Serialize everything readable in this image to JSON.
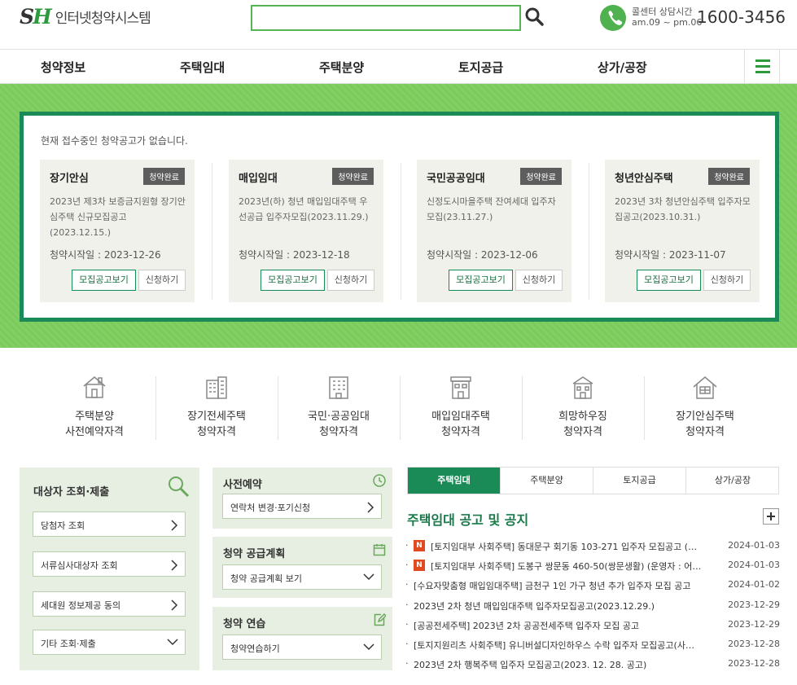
{
  "header": {
    "logo_mark_a": "S",
    "logo_mark_b": "H",
    "logo_name": "인터넷청약시스템",
    "search_placeholder": "",
    "call_label": "콜센터 상담시간",
    "call_hours": "am.09 ~ pm.06",
    "phone": "1600-3456"
  },
  "nav": [
    "청약정보",
    "주택임대",
    "주택분양",
    "토지공급",
    "상가/공장"
  ],
  "notice_box": {
    "empty_text": "현재 접수중인 청약공고가 없습니다.",
    "cards": [
      {
        "title": "장기안심",
        "badge": "청약완료",
        "desc": "2023년 제3차 보증금지원형 장기안심주택 신규모집공고(2023.12.15.)",
        "date": "청약시작일 : 2023-12-26",
        "view": "모집공고보기",
        "apply": "신청하기"
      },
      {
        "title": "매입임대",
        "badge": "청약완료",
        "desc": "2023년(하) 청년 매입임대주택 우선공급 입주자모집(2023.11.29.)",
        "date": "청약시작일 : 2023-12-18",
        "view": "모집공고보기",
        "apply": "신청하기"
      },
      {
        "title": "국민공공임대",
        "badge": "청약완료",
        "desc": "신정도시마을주택 잔여세대 입주자모집(23.11.27.)",
        "date": "청약시작일 : 2023-12-06",
        "view": "모집공고보기",
        "apply": "신청하기"
      },
      {
        "title": "청년안심주택",
        "badge": "청약완료",
        "desc": "2023년 3차 청년안심주택 입주자모집공고(2023.10.31.)",
        "date": "청약시작일 : 2023-11-07",
        "view": "모집공고보기",
        "apply": "신청하기"
      }
    ]
  },
  "quick": [
    {
      "l1": "주택분양",
      "l2": "사전예약자격"
    },
    {
      "l1": "장기전세주택",
      "l2": "청약자격"
    },
    {
      "l1": "국민·공공임대",
      "l2": "청약자격"
    },
    {
      "l1": "매입임대주택",
      "l2": "청약자격"
    },
    {
      "l1": "희망하우징",
      "l2": "청약자격"
    },
    {
      "l1": "장기안심주택",
      "l2": "청약자격"
    }
  ],
  "left_panel": {
    "title": "대상자 조회·제출",
    "items": [
      "당첨자 조회",
      "서류심사대상자 조회",
      "세대원 정보제공 동의",
      "기타 조회·제출"
    ]
  },
  "mid_panels": [
    {
      "title": "사전예약",
      "select": "연락처 변경·포기신청"
    },
    {
      "title": "청약 공급계획",
      "select": "청약 공급계획 보기"
    },
    {
      "title": "청약 연습",
      "select": "청약연습하기"
    }
  ],
  "tabs": [
    "주택임대",
    "주택분양",
    "토지공급",
    "상가/공장"
  ],
  "notice_title": "주택임대 공고 및 공지",
  "new_badge": "N",
  "notices": [
    {
      "text": "[토지임대부 사회주택] 동대문구 회기동 103-271 입주자 모집공고 (…",
      "date": "2024-01-03",
      "new": true
    },
    {
      "text": "[토지임대부 사회주택] 도봉구 쌍문동 460-50(쌍문생활) (운영자 : 어…",
      "date": "2024-01-03",
      "new": true
    },
    {
      "text": "[수요자맞춤형 매입임대주택] 금천구 1인 가구 청년 추가 입주자 모집 공고",
      "date": "2024-01-02",
      "new": false
    },
    {
      "text": "2023년 2차 청년 매입임대주택 입주자모집공고(2023.12.29.)",
      "date": "2023-12-29",
      "new": false
    },
    {
      "text": "[공공전세주택] 2023년 2차 공공전세주택 입주자 모집 공고",
      "date": "2023-12-29",
      "new": false
    },
    {
      "text": "[토지지원리츠 사회주택] 유니버설디자인하우스 수락 입주자 모집공고(사…",
      "date": "2023-12-28",
      "new": false
    },
    {
      "text": "2023년 2차 행복주택 입주자 모집공고(2023. 12. 28. 공고)",
      "date": "2023-12-28",
      "new": false
    }
  ]
}
